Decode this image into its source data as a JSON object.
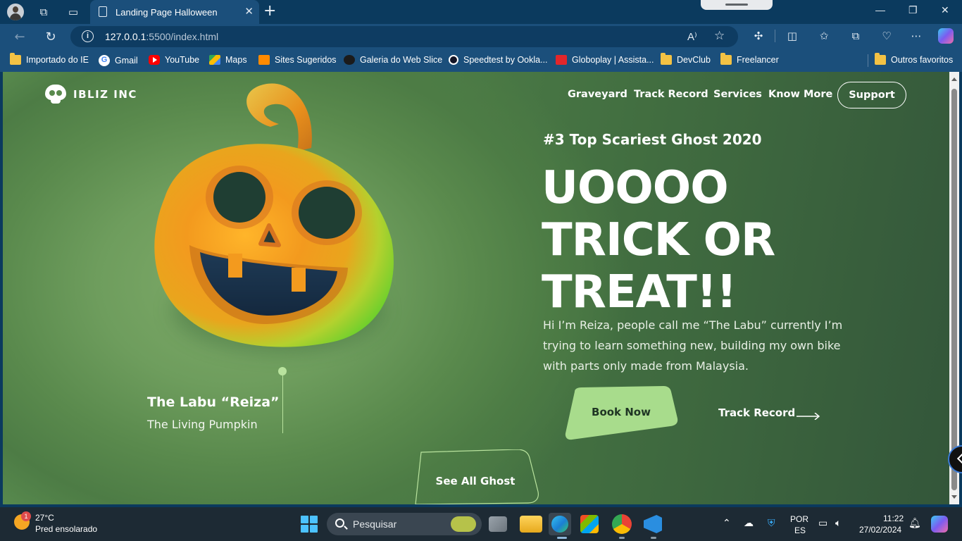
{
  "browser": {
    "tab_title": "Landing Page Halloween",
    "tab_close": "✕",
    "new_tab": "+",
    "url_host": "127.0.0.1",
    "url_rest": ":5500/index.html",
    "window_controls": {
      "minimize": "—",
      "restore": "❐",
      "close": "✕"
    },
    "read_aloud": "A⁾",
    "bookmarks": [
      {
        "label": "Importado do IE",
        "icon": "folder-icon"
      },
      {
        "label": "Gmail",
        "icon": "google-icon"
      },
      {
        "label": "YouTube",
        "icon": "youtube-icon"
      },
      {
        "label": "Maps",
        "icon": "maps-icon"
      },
      {
        "label": "Sites Sugeridos",
        "icon": "sites-icon"
      },
      {
        "label": "Galeria do Web Slice",
        "icon": "web-slice-icon"
      },
      {
        "label": "Speedtest by Ookla...",
        "icon": "speedtest-icon"
      },
      {
        "label": "Globoplay | Assista...",
        "icon": "globoplay-icon"
      },
      {
        "label": "DevClub",
        "icon": "folder-icon"
      },
      {
        "label": "Freelancer",
        "icon": "folder-icon"
      }
    ],
    "other_favorites": "Outros favoritos"
  },
  "page": {
    "logo_text": "IBLIZ INC",
    "nav": {
      "graveyard": "Graveyard",
      "track_record": "Track Record",
      "services": "Services",
      "know_more": "Know More",
      "support": "Support"
    },
    "eyebrow": "#3 Top Scariest Ghost 2020",
    "headline": {
      "line1": "UOOOO",
      "line2": "TRICK OR",
      "line3": "TREAT!!"
    },
    "description": "Hi I’m Reiza, people call me “The Labu” currently I’m trying to learn something new, building my own bike with parts only made from Malaysia.",
    "book_now": "Book Now",
    "track_record_link": "Track Record",
    "character_name": "The Labu “Reiza”",
    "character_subtitle": "The Living Pumpkin",
    "see_all": "See All Ghost",
    "colors": {
      "accent": "#a8dc8c",
      "pumpkin_orange": "#f39a1e",
      "pumpkin_green": "#6cd23a"
    }
  },
  "taskbar": {
    "weather_temp": "27°C",
    "weather_desc": "Pred ensolarado",
    "weather_badge": "1",
    "search_label": "Pesquisar",
    "lang_1": "POR",
    "lang_2": "ES",
    "time": "11:22",
    "date": "27/02/2024"
  }
}
